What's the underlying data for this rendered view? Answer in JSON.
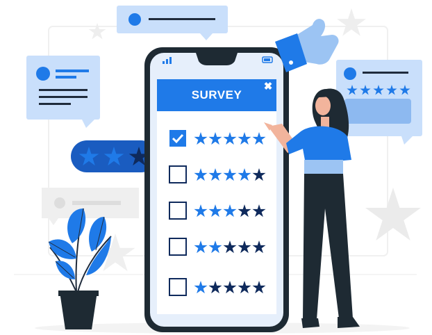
{
  "survey": {
    "title": "SURVEY",
    "close_glyph": "✖",
    "rows": [
      {
        "checked": true,
        "rating": 5
      },
      {
        "checked": false,
        "rating": 4
      },
      {
        "checked": false,
        "rating": 3
      },
      {
        "checked": false,
        "rating": 2
      },
      {
        "checked": false,
        "rating": 1
      }
    ]
  },
  "rating_pill": {
    "rating": 2,
    "max": 3
  },
  "review_card": {
    "rating": 5
  },
  "colors": {
    "primary": "#1f7ae8",
    "primary_light": "#9cc4f3",
    "dark_navy": "#0f2a5c",
    "bubble_bg": "#c9dffb",
    "phone_body": "#1e2a33",
    "screen_bg": "#e6effb",
    "skin": "#f2b49c",
    "pants": "#1e2a33",
    "grey_deco": "#ececec"
  },
  "icons": [
    "star-icon",
    "check-icon",
    "thumbs-up-icon",
    "close-icon",
    "signal-icon",
    "battery-icon"
  ]
}
